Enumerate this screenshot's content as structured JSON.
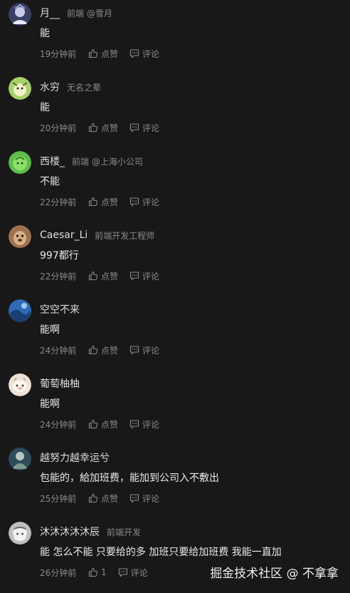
{
  "comments": [
    {
      "name": "月__",
      "meta": "前端 @雪月",
      "text": "能",
      "time": "19分钟前",
      "like": "点赞",
      "reply": "评论",
      "avatar_color": "#3a3f63"
    },
    {
      "name": "水穷",
      "meta": "无名之辈",
      "text": "能",
      "time": "20分钟前",
      "like": "点赞",
      "reply": "评论",
      "avatar_color": "#a7d26b"
    },
    {
      "name": "西楼_",
      "meta": "前端 @上海小公司",
      "text": "不能",
      "time": "22分钟前",
      "like": "点赞",
      "reply": "评论",
      "avatar_color": "#5dbd4a"
    },
    {
      "name": "Caesar_Li",
      "meta": "前端开发工程师",
      "text": "997都行",
      "time": "22分钟前",
      "like": "点赞",
      "reply": "评论",
      "avatar_color": "#a0714f"
    },
    {
      "name": "空空不来",
      "meta": "",
      "text": "能啊",
      "time": "24分钟前",
      "like": "点赞",
      "reply": "评论",
      "avatar_color": "#2f6cb8"
    },
    {
      "name": "葡萄柚柚",
      "meta": "",
      "text": "能啊",
      "time": "24分钟前",
      "like": "点赞",
      "reply": "评论",
      "avatar_color": "#efe2d6"
    },
    {
      "name": "越努力越幸运兮",
      "meta": "",
      "text": "包能的，給加班费，能加到公司入不敷出",
      "time": "25分钟前",
      "like": "点赞",
      "reply": "评论",
      "avatar_color": "#2f4c5c"
    },
    {
      "name": "沐沐沐沐沐辰",
      "meta": "前端开发",
      "text": "能 怎么不能 只要给的多 加班只要给加班费 我能一直加",
      "time": "26分钟前",
      "like": "1",
      "reply": "评论",
      "avatar_color": "#bfbfbf"
    }
  ],
  "watermark": "掘金技术社区 @ 不拿拿"
}
